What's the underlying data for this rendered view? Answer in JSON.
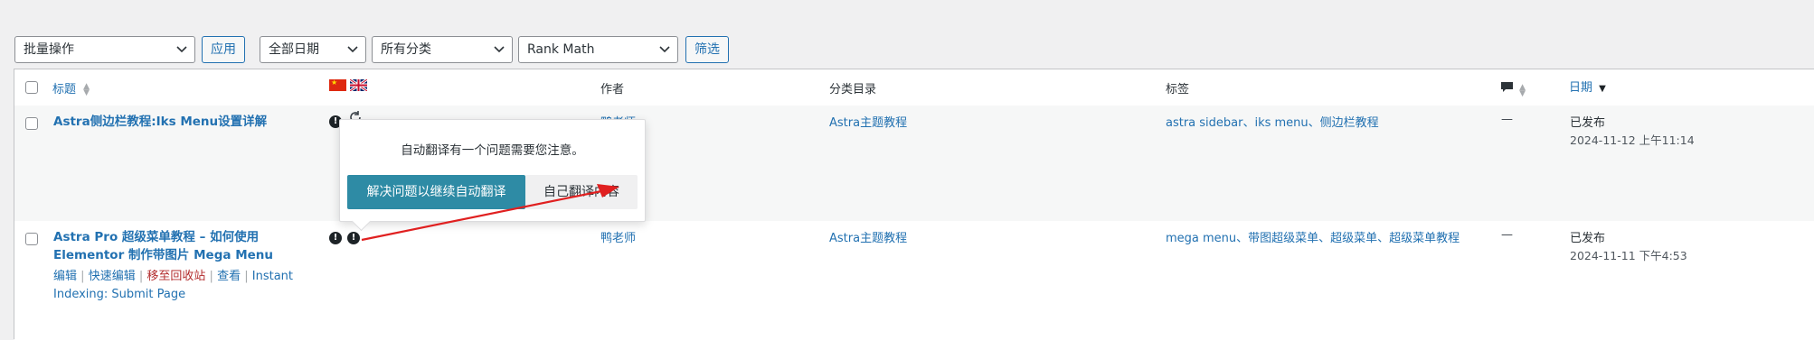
{
  "toolbar": {
    "bulk_action": "批量操作",
    "apply": "应用",
    "all_dates": "全部日期",
    "all_categories": "所有分类",
    "seo_filter": "Rank Math",
    "filter": "筛选"
  },
  "table": {
    "headers": {
      "title": "标题",
      "author": "作者",
      "categories": "分类目录",
      "tags": "标签",
      "date": "日期"
    },
    "rows": [
      {
        "title": "Astra侧边栏教程:Iks Menu设置详解",
        "author": "鸭老师",
        "category": "Astra主题教程",
        "tags": "astra sidebar、iks menu、侧边栏教程",
        "comments": "—",
        "status": "已发布",
        "date": "2024-11-12 上午11:14"
      },
      {
        "title_line1": "Astra Pro 超级菜单教程 – 如何使用",
        "title_line2": "Elementor 制作带图片 Mega Menu",
        "author": "鸭老师",
        "category": "Astra主题教程",
        "tags": "mega menu、带图超级菜单、超级菜单、超级菜单教程",
        "comments": "—",
        "status": "已发布",
        "date": "2024-11-11 下午4:53",
        "actions": {
          "edit": "编辑",
          "quick_edit": "快速编辑",
          "trash": "移至回收站",
          "view": "查看",
          "instant_1": "Instant",
          "instant_2": "Indexing: Submit Page"
        }
      }
    ]
  },
  "popup": {
    "message": "自动翻译有一个问题需要您注意。",
    "primary": "解决问题以继续自动翻译",
    "secondary": "自己翻译内容"
  },
  "icons": {
    "warning": "!",
    "separator": "|"
  },
  "colors": {
    "link": "#2271b1",
    "primary_button": "#2e8ba5",
    "annotation_arrow": "#e02020",
    "trash": "#b32d2e"
  }
}
